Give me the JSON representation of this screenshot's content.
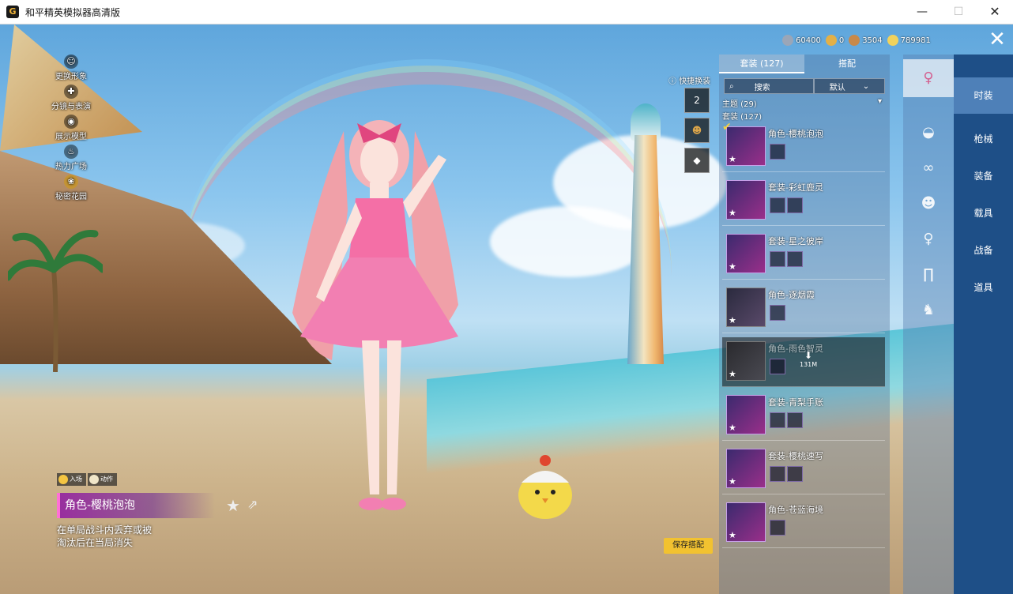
{
  "window": {
    "title": "和平精英模拟器高清版"
  },
  "left_menu": [
    "更换形象",
    "分镜与表演",
    "展示模型",
    "热力广场",
    "秘密花园"
  ],
  "currency": [
    {
      "value": "60400",
      "color": "#9aa6b8"
    },
    {
      "value": "0",
      "color": "#e3b047"
    },
    {
      "value": "3504",
      "color": "#c8894a"
    },
    {
      "value": "789981",
      "color": "#f1d25c"
    }
  ],
  "quick": {
    "label": "快捷换装",
    "slot1": "2"
  },
  "list": {
    "tab_sets": "套装 (127)",
    "tab_match": "搭配",
    "search_label": "搜索",
    "sort_label": "默认",
    "theme_label": "主题 (29)",
    "set_count": "套装 (127)",
    "items": [
      {
        "name": "角色-樱桃泡泡"
      },
      {
        "name": "套装-彩虹鹿灵"
      },
      {
        "name": "套装-星之彼岸"
      },
      {
        "name": "角色-逐烟霞"
      },
      {
        "name": "角色-雨色智灵",
        "size": "131M"
      },
      {
        "name": "套装-青梨手账"
      },
      {
        "name": "套装-樱桃速写"
      },
      {
        "name": "角色-苍蓝海境"
      }
    ]
  },
  "right_menu": [
    "时装",
    "枪械",
    "装备",
    "载具",
    "战备",
    "道具"
  ],
  "bottom": {
    "anim_entry": "入场",
    "anim_action": "动作",
    "selected_name": "角色-樱桃泡泡",
    "desc_line1": "在单局战斗内丢弃或被",
    "desc_line2": "淘汰后在当局消失",
    "save_label": "保存搭配"
  }
}
